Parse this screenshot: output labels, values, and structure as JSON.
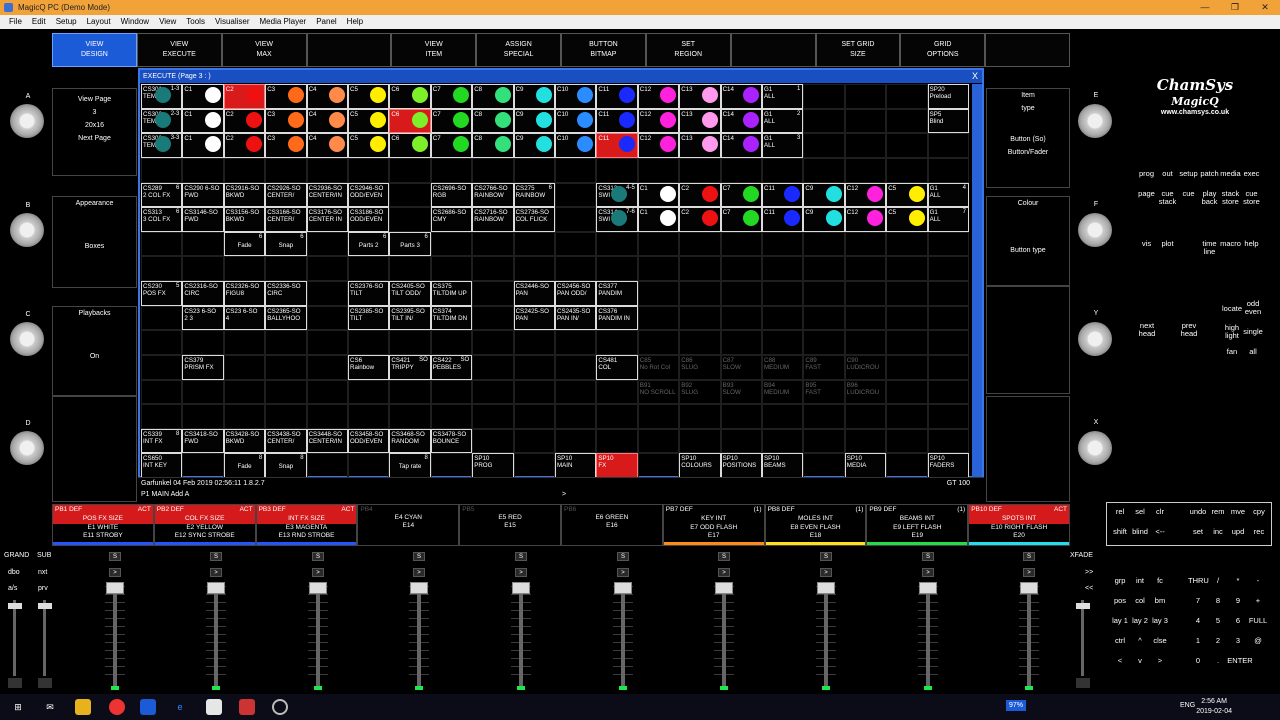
{
  "window": {
    "title": "MagicQ PC (Demo Mode)",
    "min": "—",
    "max": "❐",
    "close": "✕"
  },
  "menu": [
    "File",
    "Edit",
    "Setup",
    "Layout",
    "Window",
    "View",
    "Tools",
    "Visualiser",
    "Media Player",
    "Panel",
    "Help"
  ],
  "top_buttons": [
    {
      "l1": "VIEW",
      "l2": "DESIGN",
      "active": true
    },
    {
      "l1": "VIEW",
      "l2": "EXECUTE"
    },
    {
      "l1": "VIEW",
      "l2": "MAX"
    },
    {
      "l1": "",
      "l2": ""
    },
    {
      "l1": "VIEW",
      "l2": "ITEM"
    },
    {
      "l1": "ASSIGN",
      "l2": "SPECIAL"
    },
    {
      "l1": "BUTTON",
      "l2": "BITMAP"
    },
    {
      "l1": "SET",
      "l2": "REGION"
    },
    {
      "l1": "",
      "l2": ""
    },
    {
      "l1": "SET GRID",
      "l2": "SIZE"
    },
    {
      "l1": "GRID",
      "l2": "OPTIONS"
    },
    {
      "l1": "",
      "l2": ""
    }
  ],
  "left_panel": {
    "enc_labels": [
      "A",
      "B",
      "C",
      "D"
    ],
    "box_a": [
      "View Page",
      "3",
      "20x16",
      "Next Page"
    ],
    "box_b": [
      "Appearance",
      "Boxes"
    ],
    "box_c": [
      "Playbacks",
      "On"
    ]
  },
  "right_side": {
    "enc_labels": [
      "E",
      "F",
      "Y",
      "X"
    ],
    "box_e": [
      "Item",
      "type",
      "Button (So)",
      "Button/Fader"
    ],
    "box_f": [
      "Colour",
      "Button type"
    ]
  },
  "execute": {
    "title": "EXECUTE (Page 3 : )",
    "close": "X",
    "status_left": "Garfunkel 04 Feb 2019 02:56:11 1.8.2.7",
    "status_right": "GT 100",
    "cmd_line": "P1 MAIN   Add A",
    "cmd_arrow": ">"
  },
  "exec_rows": [
    {
      "row": 0,
      "cells": [
        {
          "c": 0,
          "t1": "CS301",
          "t2": "TEM",
          "num": "1-3",
          "dot": "#1a7a7a"
        },
        {
          "c": 1,
          "t1": "C1",
          "dot": "#ffffff"
        },
        {
          "c": 2,
          "t1": "C2",
          "dot": "#ee1111",
          "red": true
        },
        {
          "c": 3,
          "t1": "C3",
          "dot": "#ff6a1a"
        },
        {
          "c": 4,
          "t1": "C4",
          "dot": "#ff8a4a"
        },
        {
          "c": 5,
          "t1": "C5",
          "dot": "#ffee00"
        },
        {
          "c": 6,
          "t1": "C6",
          "dot": "#7ef02a"
        },
        {
          "c": 7,
          "t1": "C7",
          "dot": "#22d822"
        },
        {
          "c": 8,
          "t1": "C8",
          "dot": "#33e07a"
        },
        {
          "c": 9,
          "t1": "C9",
          "dot": "#22e0e0"
        },
        {
          "c": 10,
          "t1": "C10",
          "dot": "#2a8cff"
        },
        {
          "c": 11,
          "t1": "C11",
          "dot": "#1a2aff"
        },
        {
          "c": 12,
          "t1": "C12",
          "dot": "#ff22dd"
        },
        {
          "c": 13,
          "t1": "C13",
          "dot": "#ff99ee"
        },
        {
          "c": 14,
          "t1": "C14",
          "dot": "#aa22ff"
        },
        {
          "c": 15,
          "t1": "G1",
          "t2": "ALL",
          "num": "1"
        },
        {
          "c": 19,
          "t1": "SP20",
          "t2": "Preload"
        }
      ]
    },
    {
      "row": 1,
      "cells": [
        {
          "c": 0,
          "t1": "CS302",
          "t2": "TEM",
          "num": "2-3",
          "dot": "#1a7a7a"
        },
        {
          "c": 1,
          "t1": "C1",
          "dot": "#ffffff"
        },
        {
          "c": 2,
          "t1": "C2",
          "dot": "#ee1111"
        },
        {
          "c": 3,
          "t1": "C3",
          "dot": "#ff6a1a"
        },
        {
          "c": 4,
          "t1": "C4",
          "dot": "#ff8a4a"
        },
        {
          "c": 5,
          "t1": "C5",
          "dot": "#ffee00"
        },
        {
          "c": 6,
          "t1": "C6",
          "dot": "#7ef02a",
          "red": true
        },
        {
          "c": 7,
          "t1": "C7",
          "dot": "#22d822"
        },
        {
          "c": 8,
          "t1": "C8",
          "dot": "#33e07a"
        },
        {
          "c": 9,
          "t1": "C9",
          "dot": "#22e0e0"
        },
        {
          "c": 10,
          "t1": "C10",
          "dot": "#2a8cff"
        },
        {
          "c": 11,
          "t1": "C11",
          "dot": "#1a2aff"
        },
        {
          "c": 12,
          "t1": "C12",
          "dot": "#ff22dd"
        },
        {
          "c": 13,
          "t1": "C13",
          "dot": "#ff99ee"
        },
        {
          "c": 14,
          "t1": "C14",
          "dot": "#aa22ff"
        },
        {
          "c": 15,
          "t1": "G1",
          "t2": "ALL",
          "num": "2"
        },
        {
          "c": 19,
          "t1": "SP5",
          "t2": "Blind"
        }
      ]
    },
    {
      "row": 2,
      "cells": [
        {
          "c": 0,
          "t1": "CS303",
          "t2": "TEM",
          "num": "3-3",
          "dot": "#1a7a7a"
        },
        {
          "c": 1,
          "t1": "C1",
          "dot": "#ffffff"
        },
        {
          "c": 2,
          "t1": "C2",
          "dot": "#ee1111"
        },
        {
          "c": 3,
          "t1": "C3",
          "dot": "#ff6a1a"
        },
        {
          "c": 4,
          "t1": "C4",
          "dot": "#ff8a4a"
        },
        {
          "c": 5,
          "t1": "C5",
          "dot": "#ffee00"
        },
        {
          "c": 6,
          "t1": "C6",
          "dot": "#7ef02a"
        },
        {
          "c": 7,
          "t1": "C7",
          "dot": "#22d822"
        },
        {
          "c": 8,
          "t1": "C8",
          "dot": "#33e07a"
        },
        {
          "c": 9,
          "t1": "C9",
          "dot": "#22e0e0"
        },
        {
          "c": 10,
          "t1": "C10",
          "dot": "#2a8cff"
        },
        {
          "c": 11,
          "t1": "C11",
          "dot": "#1a2aff",
          "red": true
        },
        {
          "c": 12,
          "t1": "C12",
          "dot": "#ff22dd"
        },
        {
          "c": 13,
          "t1": "C13",
          "dot": "#ff99ee"
        },
        {
          "c": 14,
          "t1": "C14",
          "dot": "#aa22ff"
        },
        {
          "c": 15,
          "t1": "G1",
          "t2": "ALL",
          "num": "3"
        }
      ]
    },
    {
      "row": 4,
      "cells": [
        {
          "c": 0,
          "t1": "CS289",
          "t2": "2 COL FX",
          "num": "6"
        },
        {
          "c": 1,
          "t1": "CS290 6-SO",
          "t2": "FWD"
        },
        {
          "c": 2,
          "t1": "CS2916-SO",
          "t2": "BKWD"
        },
        {
          "c": 3,
          "t1": "CS2926-SO",
          "t2": "CENTER/"
        },
        {
          "c": 4,
          "t1": "CS2936-SO",
          "t2": "CENTER/IN"
        },
        {
          "c": 5,
          "t1": "CS2946-SO",
          "t2": "ODD/EVEN"
        },
        {
          "c": 7,
          "t1": "CS2696-SO",
          "t2": "RGB"
        },
        {
          "c": 8,
          "t1": "CS2766-SO",
          "t2": "RAINBOW"
        },
        {
          "c": 9,
          "t1": "CS275",
          "t2": "RAINBOW",
          "num": "6"
        },
        {
          "c": 11,
          "t1": "CS313",
          "t2": "SWI",
          "num": "4-5",
          "dot": "#1a7a7a"
        },
        {
          "c": 12,
          "t1": "C1",
          "dot": "#ffffff"
        },
        {
          "c": 13,
          "t1": "C2",
          "dot": "#ee1111"
        },
        {
          "c": 14,
          "t1": "C7",
          "dot": "#22d822"
        },
        {
          "c": 15,
          "t1": "C11",
          "dot": "#1a2aff"
        },
        {
          "c": 16,
          "t1": "C9",
          "dot": "#22e0e0"
        },
        {
          "c": 17,
          "t1": "C12",
          "dot": "#ff22dd"
        },
        {
          "c": 18,
          "t1": "C5",
          "dot": "#ffee00"
        },
        {
          "c": 19,
          "t1": "G1",
          "t2": "ALL",
          "num": "4"
        }
      ]
    },
    {
      "row": 5,
      "cells": [
        {
          "c": 0,
          "t1": "CS313",
          "t2": "3 COL FX",
          "num": "6"
        },
        {
          "c": 1,
          "t1": "CS3146-SO",
          "t2": "FWD"
        },
        {
          "c": 2,
          "t1": "CS3156-SO",
          "t2": "BKWD"
        },
        {
          "c": 3,
          "t1": "CS3166-SO",
          "t2": "CENTER/"
        },
        {
          "c": 4,
          "t1": "CS3176-SO",
          "t2": "CENTER IN"
        },
        {
          "c": 5,
          "t1": "CS3186-SO",
          "t2": "ODD/EVEN"
        },
        {
          "c": 7,
          "t1": "CS2686-SO",
          "t2": "CMY"
        },
        {
          "c": 8,
          "t1": "CS2716-SO",
          "t2": "RAINBOW"
        },
        {
          "c": 9,
          "t1": "CS2736-SO",
          "t2": "COL FLICK"
        },
        {
          "c": 11,
          "t1": "CS314",
          "t2": "SWI",
          "num": "7-6",
          "dot": "#1a7a7a"
        },
        {
          "c": 12,
          "t1": "C1",
          "dot": "#ffffff"
        },
        {
          "c": 13,
          "t1": "C2",
          "dot": "#ee1111"
        },
        {
          "c": 14,
          "t1": "C7",
          "dot": "#22d822"
        },
        {
          "c": 15,
          "t1": "C11",
          "dot": "#1a2aff"
        },
        {
          "c": 16,
          "t1": "C9",
          "dot": "#22e0e0"
        },
        {
          "c": 17,
          "t1": "C12",
          "dot": "#ff22dd"
        },
        {
          "c": 18,
          "t1": "C5",
          "dot": "#ffee00"
        },
        {
          "c": 19,
          "t1": "G1",
          "t2": "ALL",
          "num": "7"
        }
      ]
    },
    {
      "row": 6,
      "cells": [
        {
          "c": 2,
          "t1": "Fade",
          "num": "6",
          "center": true
        },
        {
          "c": 3,
          "t1": "Snap",
          "num": "6",
          "center": true
        },
        {
          "c": 5,
          "t1": "Parts 2",
          "num": "6",
          "center": true
        },
        {
          "c": 6,
          "t1": "Parts 3",
          "num": "6",
          "center": true
        }
      ]
    },
    {
      "row": 8,
      "cells": [
        {
          "c": 0,
          "t1": "CS230",
          "t2": "POS FX",
          "num": "5"
        },
        {
          "c": 1,
          "t1": "CS2316-SO",
          "t2": "CIRC"
        },
        {
          "c": 2,
          "t1": "CS2326-SO",
          "t2": "FIGU8"
        },
        {
          "c": 3,
          "t1": "CS2336-SO",
          "t2": "CIRC"
        },
        {
          "c": 5,
          "t1": "CS2376-SO",
          "t2": "TILT"
        },
        {
          "c": 6,
          "t1": "CS2405-SO",
          "t2": "TILT ODD/"
        },
        {
          "c": 7,
          "t1": "CS375",
          "t2": "TILTDIM UP"
        },
        {
          "c": 9,
          "t1": "CS2446-SO",
          "t2": "PAN"
        },
        {
          "c": 10,
          "t1": "CS2456-SO",
          "t2": "PAN ODD/"
        },
        {
          "c": 11,
          "t1": "CS377",
          "t2": "PANDIM"
        }
      ]
    },
    {
      "row": 9,
      "cells": [
        {
          "c": 1,
          "t1": "CS23 6-SO",
          "t2": "2 3"
        },
        {
          "c": 2,
          "t1": "CS23 6-SO",
          "t2": "4"
        },
        {
          "c": 3,
          "t1": "CS2365-SO",
          "t2": "BALLYHOO"
        },
        {
          "c": 5,
          "t1": "CS2385-SO",
          "t2": "TILT"
        },
        {
          "c": 6,
          "t1": "CS2395-SO",
          "t2": "TILT IN/"
        },
        {
          "c": 7,
          "t1": "CS374",
          "t2": "TILTDIM DN"
        },
        {
          "c": 9,
          "t1": "CS2425-SO",
          "t2": "PAN"
        },
        {
          "c": 10,
          "t1": "CS2435-SO",
          "t2": "PAN IN/"
        },
        {
          "c": 11,
          "t1": "CS376",
          "t2": "PANDIM IN"
        }
      ]
    },
    {
      "row": 11,
      "cells": [
        {
          "c": 1,
          "t1": "CS379",
          "t2": "PRISM FX"
        },
        {
          "c": 5,
          "t1": "CS6",
          "t2": "Rainbow"
        },
        {
          "c": 6,
          "t1": "CS421",
          "t2": "TRIPPY",
          "num": "SO"
        },
        {
          "c": 7,
          "t1": "CS422",
          "t2": "PEBBLES",
          "num": "SO"
        },
        {
          "c": 11,
          "t1": "CS481",
          "t2": "COL"
        },
        {
          "c": 12,
          "t1": "C85",
          "t2": "No Rot Col",
          "dim": true
        },
        {
          "c": 13,
          "t1": "C86",
          "t2": "SLUG",
          "dim": true
        },
        {
          "c": 14,
          "t1": "C87",
          "t2": "SLOW",
          "dim": true
        },
        {
          "c": 15,
          "t1": "C88",
          "t2": "MEDIUM",
          "dim": true
        },
        {
          "c": 16,
          "t1": "C89",
          "t2": "FAST",
          "dim": true
        },
        {
          "c": 17,
          "t1": "C90",
          "t2": "LUDICROU",
          "dim": true
        }
      ]
    },
    {
      "row": 12,
      "cells": [
        {
          "c": 12,
          "t1": "B91",
          "t2": "NO SCROLL",
          "dim": true
        },
        {
          "c": 13,
          "t1": "B92",
          "t2": "SLUG",
          "dim": true
        },
        {
          "c": 14,
          "t1": "B93",
          "t2": "SLOW",
          "dim": true
        },
        {
          "c": 15,
          "t1": "B94",
          "t2": "MEDIUM",
          "dim": true
        },
        {
          "c": 16,
          "t1": "B95",
          "t2": "FAST",
          "dim": true
        },
        {
          "c": 17,
          "t1": "B96",
          "t2": "LUDICROU",
          "dim": true
        }
      ]
    },
    {
      "row": 14,
      "cells": [
        {
          "c": 0,
          "t1": "CS339",
          "t2": "INT FX",
          "num": "8"
        },
        {
          "c": 1,
          "t1": "CS3418-SO",
          "t2": "FWD"
        },
        {
          "c": 2,
          "t1": "CS3428-SO",
          "t2": "BKWD"
        },
        {
          "c": 3,
          "t1": "CS3438-SO",
          "t2": "CENTER/"
        },
        {
          "c": 4,
          "t1": "CS3448-SO",
          "t2": "CENTER/IN"
        },
        {
          "c": 5,
          "t1": "CS3458-SO",
          "t2": "ODD/EVEN"
        },
        {
          "c": 6,
          "t1": "CS3468-SO",
          "t2": "RANDOM"
        },
        {
          "c": 7,
          "t1": "CS3478-SO",
          "t2": "BOUNCE"
        }
      ]
    },
    {
      "row": 15,
      "cells": [
        {
          "c": 0,
          "t1": "CS650",
          "t2": "INT KEY"
        },
        {
          "c": 2,
          "t1": "Fade",
          "num": "8",
          "center": true
        },
        {
          "c": 3,
          "t1": "Snap",
          "num": "8",
          "center": true
        },
        {
          "c": 6,
          "t1": "Tap rate",
          "num": "8",
          "center": true
        },
        {
          "c": 8,
          "t1": "SP10",
          "t2": "PROG"
        },
        {
          "c": 10,
          "t1": "SP10",
          "t2": "MAIN"
        },
        {
          "c": 11,
          "t1": "SP10",
          "t2": "FX",
          "red": true
        },
        {
          "c": 13,
          "t1": "SP10",
          "t2": "COLOURS"
        },
        {
          "c": 14,
          "t1": "SP10",
          "t2": "POSITIONS"
        },
        {
          "c": 15,
          "t1": "SP10",
          "t2": "BEAMS"
        },
        {
          "c": 17,
          "t1": "SP10",
          "t2": "MEDIA"
        },
        {
          "c": 19,
          "t1": "SP10",
          "t2": "FADERS"
        }
      ]
    }
  ],
  "brand": {
    "l1": "ChamSys",
    "l2": "MagicQ",
    "l3": "www.chamsys.co.uk"
  },
  "keys_top": [
    "prog",
    "out",
    "setup",
    "patch",
    "media",
    "exec",
    "page",
    "cue stack",
    "cue",
    "play back",
    "stack store",
    "cue store"
  ],
  "keys_mid": [
    "vis",
    "plot",
    "",
    "time line",
    "macro",
    "help"
  ],
  "keys_head": [
    "next head",
    "prev head",
    "locate",
    "odd even",
    "high light",
    "single",
    "fan",
    "all"
  ],
  "keys_edit": [
    "rel",
    "sel",
    "clr",
    "undo",
    "rem",
    "mve",
    "cpy",
    "shift",
    "blind",
    "<--",
    "set",
    "inc",
    "upd",
    "rec"
  ],
  "playbacks": [
    {
      "hd": "PB1 DEF",
      "act": "ACT",
      "name": "POS FX SIZE",
      "e1": "E1 WHITE",
      "e2": "E11 STROBY",
      "red": true,
      "bar": "#2255ff"
    },
    {
      "hd": "PB2 DEF",
      "act": "ACT",
      "name": "COL FX SIZE",
      "e1": "E2 YELLOW",
      "e2": "E12 SYNC STROBE",
      "red": true,
      "bar": "#2255ff"
    },
    {
      "hd": "PB3 DEF",
      "act": "ACT",
      "name": "INT FX SIZE",
      "e1": "E3 MAGENTA",
      "e2": "E13 RND STROBE",
      "red": true,
      "bar": "#2255ff"
    },
    {
      "hd": "PB4",
      "act": "",
      "name": "",
      "e1": "E4 CYAN",
      "e2": "E14",
      "grey": true,
      "bar": ""
    },
    {
      "hd": "PB5",
      "act": "",
      "name": "",
      "e1": "E5 RED",
      "e2": "E15",
      "grey": true,
      "bar": ""
    },
    {
      "hd": "PB6",
      "act": "",
      "name": "",
      "e1": "E6 GREEN",
      "e2": "E16",
      "grey": true,
      "bar": ""
    },
    {
      "hd": "PB7 DEF",
      "act": "(1)",
      "name": "KEY INT",
      "e1": "E7 ODD FLASH",
      "e2": "E17",
      "bar": "#ff8a1a"
    },
    {
      "hd": "PB8 DEF",
      "act": "(1)",
      "name": "MOLES INT",
      "e1": "E8 EVEN FLASH",
      "e2": "E18",
      "bar": "#ffe01a"
    },
    {
      "hd": "PB9 DEF",
      "act": "(1)",
      "name": "BEAMS INT",
      "e1": "E9 LEFT FLASH",
      "e2": "E19",
      "bar": "#22dd44"
    },
    {
      "hd": "PB10 DEF",
      "act": "ACT",
      "name": "SPOTS INT",
      "e1": "E10 RIGHT FLASH",
      "e2": "E20",
      "red": true,
      "bar": "#22ddee"
    }
  ],
  "faders": {
    "grand": "GRAND",
    "sub": "SUB",
    "dbo": "dbo",
    "nxt": "nxt",
    "as": "a/s",
    "prv": "prv",
    "xfade": "XFADE",
    "s_label": "S",
    "gt": ">",
    "ff": ">>",
    "rr": "<<"
  },
  "keypad": [
    [
      "grp",
      "int",
      "fc",
      "THRU",
      "/",
      "*",
      "-"
    ],
    [
      "pos",
      "col",
      "bm",
      "7",
      "8",
      "9",
      "+"
    ],
    [
      "lay 1",
      "lay 2",
      "lay 3",
      "4",
      "5",
      "6",
      "FULL"
    ],
    [
      "ctrl",
      "^",
      "clse",
      "1",
      "2",
      "3",
      "@"
    ],
    [
      "<",
      "v",
      ">",
      "0",
      ".",
      "ENTER",
      ""
    ]
  ],
  "taskbar": {
    "battery": "97%",
    "lang": "ENG",
    "time": "2:56 AM",
    "date": "2019-02-04"
  }
}
